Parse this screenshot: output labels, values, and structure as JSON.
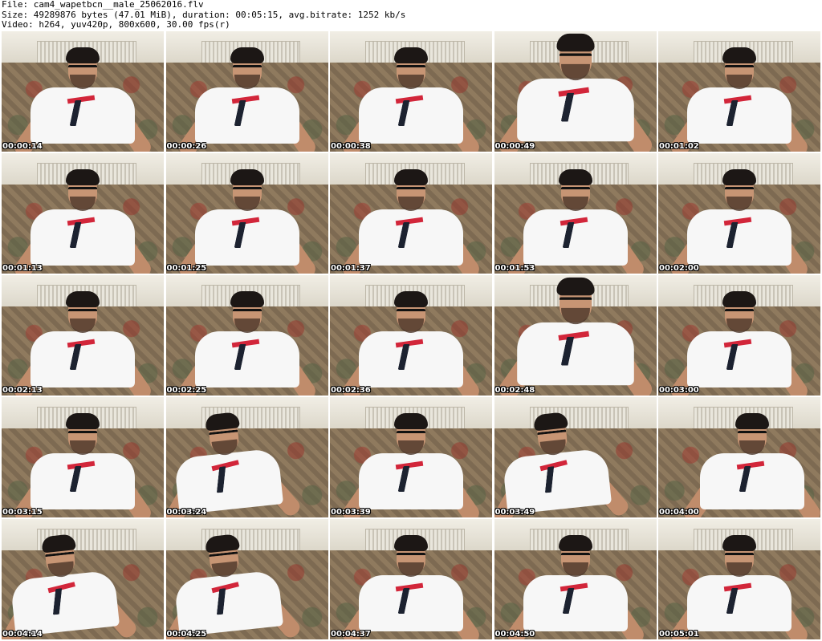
{
  "header": {
    "file_line": "File: cam4_wapetbcn__male_25062016.flv",
    "size_line": "Size: 49289876 bytes (47.01 MiB), duration: 00:05:15, avg.bitrate: 1252 kb/s",
    "video_line": "Video: h264, yuv420p, 800x600, 30.00 fps(r)"
  },
  "thumbnails": [
    {
      "timestamp": "00:00:14"
    },
    {
      "timestamp": "00:00:26"
    },
    {
      "timestamp": "00:00:38"
    },
    {
      "timestamp": "00:00:49"
    },
    {
      "timestamp": "00:01:02"
    },
    {
      "timestamp": "00:01:13"
    },
    {
      "timestamp": "00:01:25"
    },
    {
      "timestamp": "00:01:37"
    },
    {
      "timestamp": "00:01:53"
    },
    {
      "timestamp": "00:02:00"
    },
    {
      "timestamp": "00:02:13"
    },
    {
      "timestamp": "00:02:25"
    },
    {
      "timestamp": "00:02:36"
    },
    {
      "timestamp": "00:02:48"
    },
    {
      "timestamp": "00:03:00"
    },
    {
      "timestamp": "00:03:15"
    },
    {
      "timestamp": "00:03:24"
    },
    {
      "timestamp": "00:03:39"
    },
    {
      "timestamp": "00:03:49"
    },
    {
      "timestamp": "00:04:00"
    },
    {
      "timestamp": "00:04:14"
    },
    {
      "timestamp": "00:04:25"
    },
    {
      "timestamp": "00:04:37"
    },
    {
      "timestamp": "00:04:50"
    },
    {
      "timestamp": "00:05:01"
    }
  ]
}
